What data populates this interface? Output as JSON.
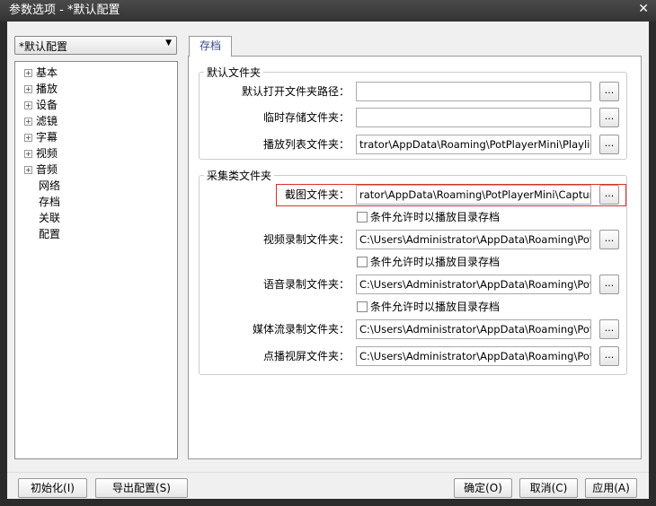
{
  "window": {
    "title": "参数选项 - *默认配置"
  },
  "profile_select": {
    "value": "*默认配置"
  },
  "tree": [
    {
      "label": "基本",
      "expandable": true
    },
    {
      "label": "播放",
      "expandable": true
    },
    {
      "label": "设备",
      "expandable": true
    },
    {
      "label": "滤镜",
      "expandable": true
    },
    {
      "label": "字幕",
      "expandable": true
    },
    {
      "label": "视频",
      "expandable": true
    },
    {
      "label": "音频",
      "expandable": true
    },
    {
      "label": "网络",
      "expandable": false
    },
    {
      "label": "存档",
      "expandable": false
    },
    {
      "label": "关联",
      "expandable": false
    },
    {
      "label": "配置",
      "expandable": false
    }
  ],
  "tab": "存档",
  "group1": {
    "title": "默认文件夹",
    "rows": [
      {
        "label": "默认打开文件夹路径：",
        "value": ""
      },
      {
        "label": "临时存储文件夹：",
        "value": ""
      },
      {
        "label": "播放列表文件夹：",
        "value": "trator\\AppData\\Roaming\\PotPlayerMini\\Playlist"
      }
    ]
  },
  "group2": {
    "title": "采集类文件夹",
    "rows": [
      {
        "label": "截图文件夹：",
        "value": "rator\\AppData\\Roaming\\PotPlayerMini\\Capture",
        "check": "条件允许时以播放目录存档"
      },
      {
        "label": "视频录制文件夹：",
        "value": "C:\\Users\\Administrator\\AppData\\Roaming\\PotP",
        "check": "条件允许时以播放目录存档"
      },
      {
        "label": "语音录制文件夹：",
        "value": "C:\\Users\\Administrator\\AppData\\Roaming\\PotP",
        "check": "条件允许时以播放目录存档"
      },
      {
        "label": "媒体流录制文件夹：",
        "value": "C:\\Users\\Administrator\\AppData\\Roaming\\PotP"
      },
      {
        "label": "点播视屏文件夹：",
        "value": "C:\\Users\\Administrator\\AppData\\Roaming\\PotP"
      }
    ]
  },
  "browse_label": "...",
  "footer": {
    "init": "初始化(I)",
    "export": "导出配置(S)",
    "ok": "确定(O)",
    "cancel": "取消(C)",
    "apply": "应用(A)"
  },
  "close_glyph": "✕",
  "dropdown_glyph": "▼",
  "plus_glyph": "+"
}
